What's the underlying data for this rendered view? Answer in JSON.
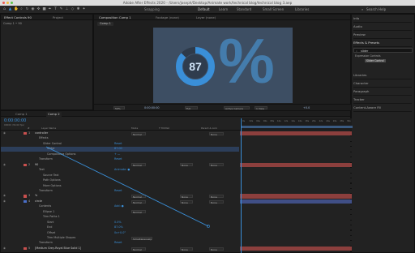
{
  "app": {
    "title": "Adobe After Effects 2020 - /Users/joseph/Desktop/Animate work/technical blog/technical blog 3.aep"
  },
  "workspaces": [
    "Default",
    "Learn",
    "Standard",
    "Small Screen",
    "Libraries"
  ],
  "search": {
    "label": "Search Help"
  },
  "snapping": {
    "label": "Snapping"
  },
  "project_panel": {
    "tabs": [
      "Effect Controls 90",
      "Project"
    ],
    "subtitle": "Comp 1 • 90"
  },
  "viewer": {
    "tabs": [
      "Composition Comp 1",
      "Footage (none)",
      "Layer (none)"
    ],
    "comp_tab": "Comp 1",
    "percent_value": "87",
    "percent_sign": "%",
    "accent": "#3a8fd8",
    "zoom": "50%",
    "timecode": "0:00:00:00",
    "resolution": "Full",
    "camera": "Active Camera",
    "views": "1 View",
    "exposure": "+0.0"
  },
  "right_panel": {
    "items": [
      "Info",
      "Audio",
      "Preview",
      "Effects & Presets",
      "Libraries",
      "Character",
      "Paragraph",
      "Tracker",
      "Content-Aware Fill"
    ],
    "search_value": "slider",
    "tree_folder": "Expression Controls",
    "tree_item": "Slider Control"
  },
  "timeline": {
    "tabs": [
      "Comp 1",
      "Comp 2"
    ],
    "timecode": "0:00:00:00",
    "timecode_sub": "00000 (30.00 fps)",
    "columns": [
      "#",
      "Layer Name",
      "Mode",
      "T TrkMat",
      "Parent & Link"
    ],
    "ruler": [
      "0s",
      "02s",
      "04s",
      "06s",
      "08s",
      "10s",
      "12s",
      "14s",
      "16s",
      "18s",
      "20s",
      "22s",
      "24s",
      "26s",
      "28s",
      "30s"
    ],
    "rows": [
      {
        "num": "1",
        "name": "controller",
        "chip": "#c8504e",
        "indent": 0,
        "mode": "Normal",
        "trkmat": "",
        "parent": "None",
        "val": ""
      },
      {
        "num": "",
        "name": "Effects",
        "chip": "",
        "indent": 1,
        "mode": "",
        "trkmat": "",
        "parent": "",
        "val": ""
      },
      {
        "num": "",
        "name": "Slider Control",
        "chip": "",
        "indent": 2,
        "mode": "",
        "trkmat": "",
        "parent": "",
        "val": "Reset"
      },
      {
        "num": "",
        "name": "Slider",
        "chip": "",
        "indent": 3,
        "mode": "",
        "trkmat": "",
        "parent": "",
        "val": "87.00"
      },
      {
        "num": "",
        "name": "Compositing Options",
        "chip": "",
        "indent": 3,
        "mode": "",
        "trkmat": "",
        "parent": "",
        "val": "+ —"
      },
      {
        "num": "",
        "name": "Transform",
        "chip": "",
        "indent": 1,
        "mode": "",
        "trkmat": "",
        "parent": "",
        "val": "Reset"
      },
      {
        "num": "2",
        "name": "90",
        "chip": "#c8504e",
        "indent": 0,
        "mode": "Normal",
        "trkmat": "None",
        "parent": "None",
        "val": ""
      },
      {
        "num": "",
        "name": "Text",
        "chip": "",
        "indent": 1,
        "mode": "",
        "trkmat": "",
        "parent": "",
        "val": "Animate: ●"
      },
      {
        "num": "",
        "name": "Source Text",
        "chip": "",
        "indent": 2,
        "mode": "",
        "trkmat": "",
        "parent": "",
        "val": ""
      },
      {
        "num": "",
        "name": "Path Options",
        "chip": "",
        "indent": 2,
        "mode": "",
        "trkmat": "",
        "parent": "",
        "val": ""
      },
      {
        "num": "",
        "name": "More Options",
        "chip": "",
        "indent": 2,
        "mode": "",
        "trkmat": "",
        "parent": "",
        "val": ""
      },
      {
        "num": "",
        "name": "Transform",
        "chip": "",
        "indent": 1,
        "mode": "",
        "trkmat": "",
        "parent": "",
        "val": "Reset"
      },
      {
        "num": "3",
        "name": "%",
        "chip": "#c8504e",
        "indent": 0,
        "mode": "Normal",
        "trkmat": "None",
        "parent": "None",
        "val": ""
      },
      {
        "num": "4",
        "name": "circle",
        "chip": "#4a6fc8",
        "indent": 0,
        "mode": "Normal",
        "trkmat": "None",
        "parent": "None",
        "val": ""
      },
      {
        "num": "",
        "name": "Contents",
        "chip": "",
        "indent": 1,
        "mode": "",
        "trkmat": "",
        "parent": "",
        "val": "Add: ●"
      },
      {
        "num": "",
        "name": "Ellipse 1",
        "chip": "",
        "indent": 2,
        "mode": "Normal",
        "trkmat": "",
        "parent": "",
        "val": ""
      },
      {
        "num": "",
        "name": "Trim Paths 1",
        "chip": "",
        "indent": 2,
        "mode": "",
        "trkmat": "",
        "parent": "",
        "val": ""
      },
      {
        "num": "",
        "name": "Start",
        "chip": "",
        "indent": 3,
        "mode": "",
        "trkmat": "",
        "parent": "",
        "val": "0.0%"
      },
      {
        "num": "",
        "name": "End",
        "chip": "",
        "indent": 3,
        "mode": "",
        "trkmat": "",
        "parent": "",
        "val": "87.0%"
      },
      {
        "num": "",
        "name": "Offset",
        "chip": "",
        "indent": 3,
        "mode": "",
        "trkmat": "",
        "parent": "",
        "val": "0x+0.0°"
      },
      {
        "num": "",
        "name": "Trim Multiple Shapes",
        "chip": "",
        "indent": 3,
        "mode": "Simultaneously",
        "trkmat": "",
        "parent": "",
        "val": ""
      },
      {
        "num": "",
        "name": "Transform",
        "chip": "",
        "indent": 1,
        "mode": "",
        "trkmat": "",
        "parent": "",
        "val": "Reset"
      },
      {
        "num": "5",
        "name": "[Medium Grey-Royal Blue Solid 1]",
        "chip": "#c8504e",
        "indent": 0,
        "mode": "Normal",
        "trkmat": "None",
        "parent": "None",
        "val": ""
      }
    ]
  }
}
